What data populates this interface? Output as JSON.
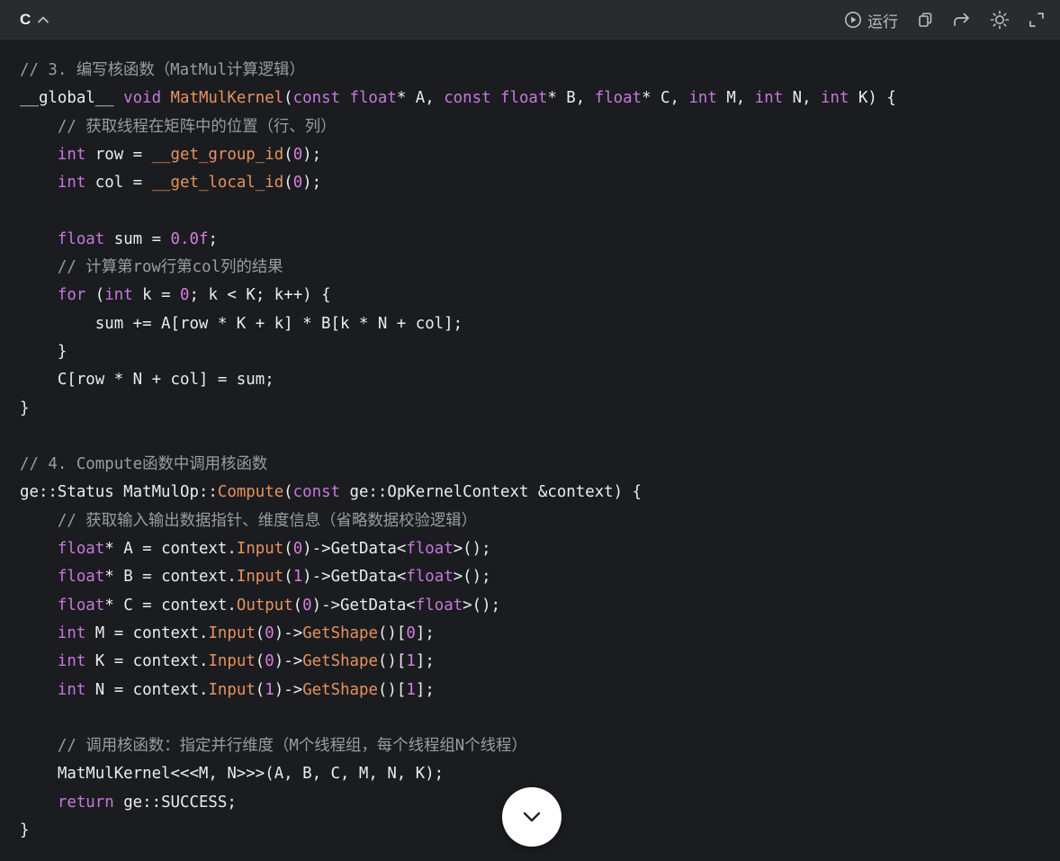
{
  "header": {
    "language": "C",
    "run_label": "运行"
  },
  "icons": {
    "collapse": "chevron-up-icon",
    "run": "play-circle-icon",
    "copy": "copy-icon",
    "share": "share-arrow-icon",
    "theme": "sun-icon",
    "fullscreen": "expand-icon",
    "scroll_down": "chevron-down-icon"
  },
  "colors": {
    "background": "#1b1c1f",
    "header": "#2a2b2e",
    "keyword": "#c678dd",
    "function": "#e7925f",
    "comment": "#9a9ca2",
    "number": "#d47ee0"
  },
  "code_lines": [
    [
      [
        "c",
        "// 3. 编写核函数（MatMul计算逻辑）"
      ]
    ],
    [
      [
        "p",
        "__global__ "
      ],
      [
        "k",
        "void "
      ],
      [
        "f",
        "MatMulKernel"
      ],
      [
        "p",
        "("
      ],
      [
        "k",
        "const float"
      ],
      [
        "p",
        "* A, "
      ],
      [
        "k",
        "const float"
      ],
      [
        "p",
        "* B, "
      ],
      [
        "k",
        "float"
      ],
      [
        "p",
        "* C, "
      ],
      [
        "k",
        "int"
      ],
      [
        "p",
        " M, "
      ],
      [
        "k",
        "int"
      ],
      [
        "p",
        " N, "
      ],
      [
        "k",
        "int"
      ],
      [
        "p",
        " K) {"
      ]
    ],
    [
      [
        "p",
        "    "
      ],
      [
        "c",
        "// 获取线程在矩阵中的位置（行、列）"
      ]
    ],
    [
      [
        "p",
        "    "
      ],
      [
        "k",
        "int"
      ],
      [
        "p",
        " row = "
      ],
      [
        "f",
        "__get_group_id"
      ],
      [
        "p",
        "("
      ],
      [
        "n",
        "0"
      ],
      [
        "p",
        ");"
      ]
    ],
    [
      [
        "p",
        "    "
      ],
      [
        "k",
        "int"
      ],
      [
        "p",
        " col = "
      ],
      [
        "f",
        "__get_local_id"
      ],
      [
        "p",
        "("
      ],
      [
        "n",
        "0"
      ],
      [
        "p",
        ");"
      ]
    ],
    [],
    [
      [
        "p",
        "    "
      ],
      [
        "k",
        "float"
      ],
      [
        "p",
        " sum = "
      ],
      [
        "n",
        "0.0f"
      ],
      [
        "p",
        ";"
      ]
    ],
    [
      [
        "p",
        "    "
      ],
      [
        "c",
        "// 计算第row行第col列的结果"
      ]
    ],
    [
      [
        "p",
        "    "
      ],
      [
        "k",
        "for"
      ],
      [
        "p",
        " ("
      ],
      [
        "k",
        "int"
      ],
      [
        "p",
        " k = "
      ],
      [
        "n",
        "0"
      ],
      [
        "p",
        "; k < K; k++) {"
      ]
    ],
    [
      [
        "p",
        "        sum += A[row * K + k] * B[k * N + col];"
      ]
    ],
    [
      [
        "p",
        "    }"
      ]
    ],
    [
      [
        "p",
        "    C[row * N + col] = sum;"
      ]
    ],
    [
      [
        "p",
        "}"
      ]
    ],
    [],
    [
      [
        "c",
        "// 4. Compute函数中调用核函数"
      ]
    ],
    [
      [
        "p",
        "ge::Status MatMulOp::"
      ],
      [
        "f",
        "Compute"
      ],
      [
        "p",
        "("
      ],
      [
        "k",
        "const"
      ],
      [
        "p",
        " ge::OpKernelContext &context) {"
      ]
    ],
    [
      [
        "p",
        "    "
      ],
      [
        "c",
        "// 获取输入输出数据指针、维度信息（省略数据校验逻辑）"
      ]
    ],
    [
      [
        "p",
        "    "
      ],
      [
        "k",
        "float"
      ],
      [
        "p",
        "* A = context."
      ],
      [
        "f",
        "Input"
      ],
      [
        "p",
        "("
      ],
      [
        "n",
        "0"
      ],
      [
        "p",
        ")->GetData<"
      ],
      [
        "k",
        "float"
      ],
      [
        "p",
        ">();"
      ]
    ],
    [
      [
        "p",
        "    "
      ],
      [
        "k",
        "float"
      ],
      [
        "p",
        "* B = context."
      ],
      [
        "f",
        "Input"
      ],
      [
        "p",
        "("
      ],
      [
        "n",
        "1"
      ],
      [
        "p",
        ")->GetData<"
      ],
      [
        "k",
        "float"
      ],
      [
        "p",
        ">();"
      ]
    ],
    [
      [
        "p",
        "    "
      ],
      [
        "k",
        "float"
      ],
      [
        "p",
        "* C = context."
      ],
      [
        "f",
        "Output"
      ],
      [
        "p",
        "("
      ],
      [
        "n",
        "0"
      ],
      [
        "p",
        ")->GetData<"
      ],
      [
        "k",
        "float"
      ],
      [
        "p",
        ">();"
      ]
    ],
    [
      [
        "p",
        "    "
      ],
      [
        "k",
        "int"
      ],
      [
        "p",
        " M = context."
      ],
      [
        "f",
        "Input"
      ],
      [
        "p",
        "("
      ],
      [
        "n",
        "0"
      ],
      [
        "p",
        ")->"
      ],
      [
        "f",
        "GetShape"
      ],
      [
        "p",
        "()["
      ],
      [
        "n",
        "0"
      ],
      [
        "p",
        "];"
      ]
    ],
    [
      [
        "p",
        "    "
      ],
      [
        "k",
        "int"
      ],
      [
        "p",
        " K = context."
      ],
      [
        "f",
        "Input"
      ],
      [
        "p",
        "("
      ],
      [
        "n",
        "0"
      ],
      [
        "p",
        ")->"
      ],
      [
        "f",
        "GetShape"
      ],
      [
        "p",
        "()["
      ],
      [
        "n",
        "1"
      ],
      [
        "p",
        "];"
      ]
    ],
    [
      [
        "p",
        "    "
      ],
      [
        "k",
        "int"
      ],
      [
        "p",
        " N = context."
      ],
      [
        "f",
        "Input"
      ],
      [
        "p",
        "("
      ],
      [
        "n",
        "1"
      ],
      [
        "p",
        ")->"
      ],
      [
        "f",
        "GetShape"
      ],
      [
        "p",
        "()["
      ],
      [
        "n",
        "1"
      ],
      [
        "p",
        "];"
      ]
    ],
    [],
    [
      [
        "p",
        "    "
      ],
      [
        "c",
        "// 调用核函数：指定并行维度（M个线程组，每个线程组N个线程）"
      ]
    ],
    [
      [
        "p",
        "    MatMulKernel<<<M, N>>>(A, B, C, M, N, K);"
      ]
    ],
    [
      [
        "p",
        "    "
      ],
      [
        "k",
        "return"
      ],
      [
        "p",
        " ge::SUCCESS;"
      ]
    ],
    [
      [
        "p",
        "}"
      ]
    ]
  ]
}
